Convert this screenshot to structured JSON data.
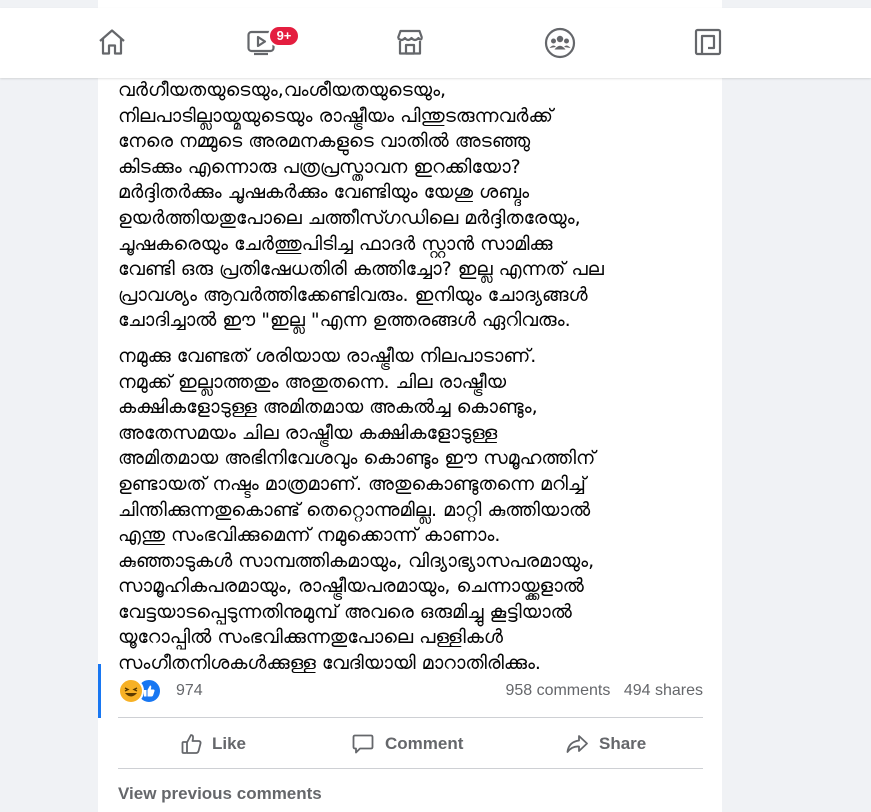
{
  "topbar": {
    "nav": [
      {
        "name": "home",
        "icon": "home-icon"
      },
      {
        "name": "watch",
        "icon": "video-icon",
        "badge": "9+"
      },
      {
        "name": "marketplace",
        "icon": "marketplace-icon"
      },
      {
        "name": "groups",
        "icon": "groups-icon"
      },
      {
        "name": "gaming",
        "icon": "gaming-icon"
      }
    ],
    "badge_color": "#e41e3f"
  },
  "post": {
    "paragraphs": [
      "വർഗീയതയുടെയും,വംശീയതയുടെയും,\nനിലപാടില്ലായ്മയുടെയും രാഷ്ട്രീയം പിന്തുടരുന്നവർക്ക്\nനേരെ നമ്മുടെ അരമനകളുടെ വാതിൽ അടഞ്ഞു\nകിടക്കും എന്നൊരു പത്രപ്രസ്താവന ഇറക്കിയോ?\nമർദ്ദിതർക്കും ചൂഷകർക്കും വേണ്ടിയും യേശു ശബ്ദം\nഉയർത്തിയതുപോലെ ചത്തീസ്ഗഡിലെ മർദ്ദിതരേയും,\nചൂഷകരെയും ചേർത്തുപിടിച്ച ഫാദർ സ്റ്റാൻ സാമിക്കു\nവേണ്ടി ഒരു പ്രതിഷേധതിരി കത്തിച്ചോ? ഇല്ല എന്നത് പല\nപ്രാവശ്യം ആവർത്തിക്കേണ്ടിവരും. ഇനിയും ചോദ്യങ്ങൾ\nചോദിച്ചാൽ ഈ \"ഇല്ല \"എന്ന ഉത്തരങ്ങൾ ഏറിവരും.",
      "നമുക്കു വേണ്ടത് ശരിയായ രാഷ്ട്രീയ നിലപാടാണ്.\nനമുക്ക് ഇല്ലാത്തതും അതുതന്നെ. ചില രാഷ്ട്രീയ\nകക്ഷികളോടുള്ള അമിതമായ അകൽച്ച കൊണ്ടും,\nഅതേസമയം ചില രാഷ്ട്രീയ കക്ഷികളോടുള്ള\nഅമിതമായ അഭിനിവേശവും കൊണ്ടും ഈ സമൂഹത്തിന്\nഉണ്ടായത് നഷ്ടം മാത്രമാണ്. അതുകൊണ്ടുതന്നെ മറിച്ച്\nചിന്തിക്കുന്നതുകൊണ്ട് തെറ്റൊന്നുമില്ല. മാറ്റി കുത്തിയാൽ\nഎന്തു സംഭവിക്കുമെന്ന് നമുക്കൊന്ന് കാണാം.\nകുഞ്ഞാടുകൾ സാമ്പത്തികമായും, വിദ്യാഭ്യാസപരമായും,\nസാമൂഹികപരമായും, രാഷ്ട്രീയപരമായും, ചെന്നായ്ക്കളാൽ\nവേട്ടയാടപ്പെടുന്നതിനുമുമ്പ് അവരെ ഒരുമിച്ചു കൂട്ടിയാൽ\nയൂറോപ്പിൽ സംഭവിക്കുന്നതുപോലെ പള്ളികൾ\nസംഗീതനിശകൾക്കുള്ള വേദിയായി മാറാതിരിക്കും."
    ],
    "reactions": {
      "icons": [
        "haha-icon",
        "like-reaction-icon"
      ],
      "count": "974"
    },
    "comments_label": "958 comments",
    "shares_label": "494 shares",
    "actions": {
      "like": "Like",
      "comment": "Comment",
      "share": "Share"
    },
    "view_previous": "View previous comments",
    "accent_color": "#1877f2"
  }
}
